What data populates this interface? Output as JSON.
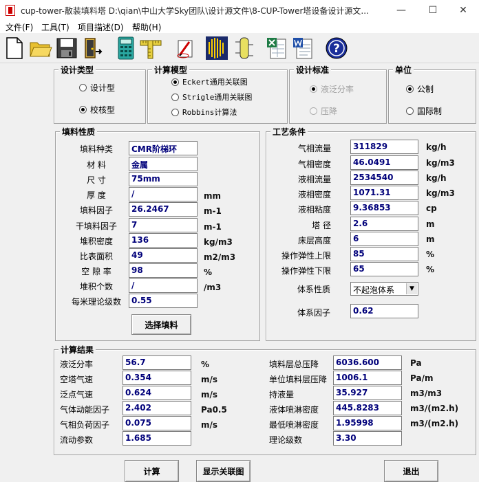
{
  "window": {
    "title": "cup-tower-散装填料塔    D:\\qian\\中山大学Sky团队\\设计源文件\\8-CUP-Tower塔设备设计源文...",
    "min_glyph": "—",
    "max_glyph": "☐",
    "close_glyph": "✕"
  },
  "menu": [
    "文件(F)",
    "工具(T)",
    "项目描述(D)",
    "帮助(H)"
  ],
  "toolbar": [
    "new-file-icon",
    "open-folder-icon",
    "save-disk-icon",
    "exit-door-icon",
    "calculator-icon",
    "ruler-icon",
    "drawing-icon",
    "chart-spray-icon",
    "tower-icon",
    "excel-export-icon",
    "word-export-icon",
    "help-icon"
  ],
  "design_type": {
    "title": "设计类型",
    "options": [
      {
        "label": "设计型",
        "selected": false
      },
      {
        "label": "校核型",
        "selected": true
      }
    ]
  },
  "calc_model": {
    "title": "计算模型",
    "options": [
      {
        "label": "Eckert通用关联图",
        "selected": true
      },
      {
        "label": "Strigle通用关联图",
        "selected": false
      },
      {
        "label": "Robbins计算法",
        "selected": false
      }
    ]
  },
  "design_standard": {
    "title": "设计标准",
    "options": [
      {
        "label": "液泛分率",
        "selected": true
      },
      {
        "label": "压降",
        "selected": false
      }
    ]
  },
  "unit": {
    "title": "单位",
    "options": [
      {
        "label": "公制",
        "selected": true
      },
      {
        "label": "国际制",
        "selected": false
      }
    ]
  },
  "packing": {
    "title": "填料性质",
    "rows": [
      {
        "label": "填料种类",
        "value": "CMR阶梯环",
        "unit": ""
      },
      {
        "label": "材    料",
        "value": "金属",
        "unit": ""
      },
      {
        "label": "尺    寸",
        "value": "75mm",
        "unit": ""
      },
      {
        "label": "厚    度",
        "value": "/",
        "unit": "mm"
      },
      {
        "label": "填料因子",
        "value": "26.2467",
        "unit": "m-1"
      },
      {
        "label": "干填料因子",
        "value": "7",
        "unit": "m-1"
      },
      {
        "label": "堆积密度",
        "value": "136",
        "unit": "kg/m3"
      },
      {
        "label": "比表面积",
        "value": "49",
        "unit": "m2/m3"
      },
      {
        "label": "空 隙 率",
        "value": "98",
        "unit": "%"
      },
      {
        "label": "堆积个数",
        "value": "/",
        "unit": "/m3"
      },
      {
        "label": "每米理论级数",
        "value": "0.55",
        "unit": ""
      }
    ],
    "select_button": "选择填料"
  },
  "process": {
    "title": "工艺条件",
    "rows": [
      {
        "label": "气相流量",
        "value": "311829",
        "unit": "kg/h"
      },
      {
        "label": "气相密度",
        "value": "46.0491",
        "unit": "kg/m3"
      },
      {
        "label": "液相流量",
        "value": "2534540",
        "unit": "kg/h"
      },
      {
        "label": "液相密度",
        "value": "1071.31",
        "unit": "kg/m3"
      },
      {
        "label": "液相粘度",
        "value": "9.36853",
        "unit": "cp"
      },
      {
        "label": "塔    径",
        "value": "2.6",
        "unit": "m"
      },
      {
        "label": "床层高度",
        "value": "6",
        "unit": "m"
      },
      {
        "label": "操作弹性上限",
        "value": "85",
        "unit": "%"
      },
      {
        "label": "操作弹性下限",
        "value": "65",
        "unit": "%"
      }
    ],
    "system_nature_label": "体系性质",
    "system_nature_value": "不起泡体系",
    "system_factor_label": "体系因子",
    "system_factor_value": "0.62"
  },
  "results": {
    "title": "计算结果",
    "left": [
      {
        "label": "液泛分率",
        "value": "56.7",
        "unit": "%"
      },
      {
        "label": "空塔气速",
        "value": "0.354",
        "unit": "m/s"
      },
      {
        "label": "泛点气速",
        "value": "0.624",
        "unit": "m/s"
      },
      {
        "label": "气体动能因子",
        "value": "2.402",
        "unit": "Pa0.5"
      },
      {
        "label": "气相负荷因子",
        "value": "0.075",
        "unit": "m/s"
      },
      {
        "label": "流动参数",
        "value": "1.685",
        "unit": ""
      }
    ],
    "right": [
      {
        "label": "填料层总压降",
        "value": "6036.600",
        "unit": "Pa"
      },
      {
        "label": "单位填料层压降",
        "value": "1006.1",
        "unit": "Pa/m"
      },
      {
        "label": "持液量",
        "value": "35.927",
        "unit": "m3/m3"
      },
      {
        "label": "液体喷淋密度",
        "value": "445.8283",
        "unit": "m3/(m2.h)"
      },
      {
        "label": "最低喷淋密度",
        "value": "1.95998",
        "unit": "m3/(m2.h)"
      },
      {
        "label": "理论级数",
        "value": "3.30",
        "unit": ""
      }
    ]
  },
  "buttons": {
    "calculate": "计算",
    "show_chart": "显示关联图",
    "exit": "退出"
  }
}
